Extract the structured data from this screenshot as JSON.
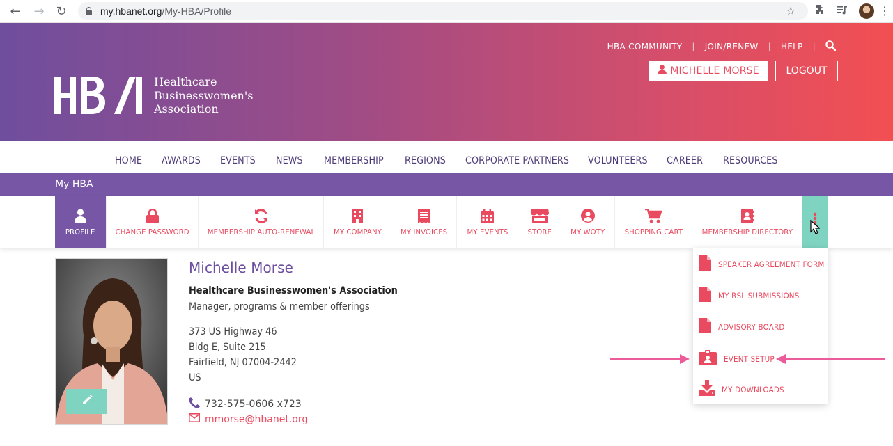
{
  "browser": {
    "url_host": "my.hbanet.org",
    "url_path": "/My-HBA/Profile"
  },
  "brand": {
    "logo_letters": "HBA",
    "name_line1": "Healthcare",
    "name_line2": "Businesswomen's",
    "name_line3": "Association"
  },
  "utility_nav": {
    "community": "HBA COMMUNITY",
    "join": "JOIN/RENEW",
    "help": "HELP",
    "sep": "|",
    "user_button": "MICHELLE MORSE",
    "logout_button": "LOGOUT"
  },
  "main_nav": [
    "HOME",
    "AWARDS",
    "EVENTS",
    "NEWS",
    "MEMBERSHIP",
    "REGIONS",
    "CORPORATE PARTNERS",
    "VOLUNTEERS",
    "CAREER",
    "RESOURCES"
  ],
  "section_bar": {
    "title": "My HBA"
  },
  "tabs": [
    {
      "label": "PROFILE",
      "icon": "user-icon"
    },
    {
      "label": "CHANGE PASSWORD",
      "icon": "lock-icon"
    },
    {
      "label": "MEMBERSHIP AUTO-RENEWAL",
      "icon": "refresh-icon"
    },
    {
      "label": "MY COMPANY",
      "icon": "building-icon"
    },
    {
      "label": "MY INVOICES",
      "icon": "receipt-icon"
    },
    {
      "label": "MY EVENTS",
      "icon": "calendar-icon"
    },
    {
      "label": "STORE",
      "icon": "store-icon"
    },
    {
      "label": "MY WOTY",
      "icon": "user-circle-icon"
    },
    {
      "label": "SHOPPING CART",
      "icon": "cart-icon"
    },
    {
      "label": "MEMBERSHIP DIRECTORY",
      "icon": "address-book-icon"
    }
  ],
  "more_menu": {
    "icon": "more-vertical-icon",
    "items": [
      {
        "label": "SPEAKER AGREEMENT FORM",
        "icon": "file-icon"
      },
      {
        "label": "MY RSL SUBMISSIONS",
        "icon": "file-icon"
      },
      {
        "label": "ADVISORY BOARD",
        "icon": "file-icon"
      },
      {
        "label": "EVENT SETUP",
        "icon": "id-badge-icon"
      },
      {
        "label": "MY DOWNLOADS",
        "icon": "download-icon"
      }
    ]
  },
  "profile": {
    "name": "Michelle Morse",
    "organization": "Healthcare Businesswomen's Association",
    "title": "Manager, programs & member offerings",
    "address_line1": "373 US Highway 46",
    "address_line2": "Bldg E, Suite 215",
    "address_line3": "Fairfield, NJ 07004-2442",
    "address_line4": "US",
    "phone": "732-575-0606 x723",
    "email": "mmorse@hbanet.org"
  },
  "colors": {
    "purple": "#7756a6",
    "coral": "#e94a5f",
    "teal": "#7fd4c1",
    "arrow_pink": "#ec5b9a"
  }
}
